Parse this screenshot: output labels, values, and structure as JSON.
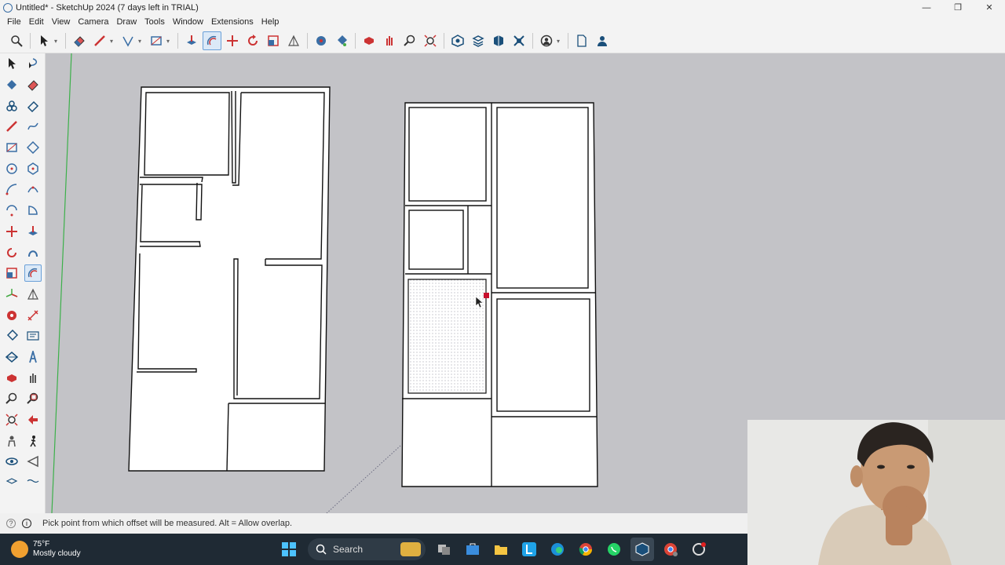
{
  "window": {
    "title": "Untitled* - SketchUp 2024 (7 days left in TRIAL)",
    "controls": [
      "—",
      "❐",
      "✕"
    ]
  },
  "menu": [
    "File",
    "Edit",
    "View",
    "Camera",
    "Draw",
    "Tools",
    "Window",
    "Extensions",
    "Help"
  ],
  "toolbar": {
    "tools": [
      "search-icon",
      "select-icon",
      "eraser-icon",
      "pencil-icon",
      "polyline-icon",
      "rectangle-icon",
      "push-pull-icon",
      "offset-icon",
      "move-icon",
      "rotate-icon",
      "scale-icon",
      "protractor-icon",
      "tape-measure-icon",
      "paint-bucket-icon",
      "orbit-icon",
      "pan-icon",
      "zoom-icon",
      "zoom-extents-icon",
      "warehouse-icon",
      "extension-icon",
      "components-icon",
      "trimble-icon",
      "profile-icon",
      "new-file-icon",
      "account-icon"
    ],
    "active_tool": "offset-icon"
  },
  "palette": {
    "active_tool": "offset-icon",
    "tools": [
      "select",
      "lasso",
      "paint",
      "eraser",
      "tag",
      "eraser2",
      "line",
      "freehand",
      "rectangle",
      "rotated-rect",
      "circle",
      "polygon",
      "arc",
      "arc2",
      "pie",
      "arc3",
      "move",
      "push-pull",
      "rotate",
      "follow-me",
      "scale",
      "offset",
      "tape",
      "protractor",
      "axes",
      "section",
      "dimension",
      "text",
      "paint-bucket",
      "3d-text",
      "orbit",
      "pan",
      "zoom",
      "zoom-window",
      "zoom-extents",
      "previous",
      "walk",
      "position-camera",
      "look-around",
      "section-plane"
    ]
  },
  "status": {
    "message": "Pick point from which offset will be measured. Alt = Allow overlap."
  },
  "taskbar": {
    "weather_temp": "75°F",
    "weather_desc": "Mostly cloudy",
    "search_label": "Search"
  },
  "colors": {
    "canvas": "#c3c3c7",
    "accent": "#6aa0d8",
    "taskbar": "#1f2a34"
  }
}
